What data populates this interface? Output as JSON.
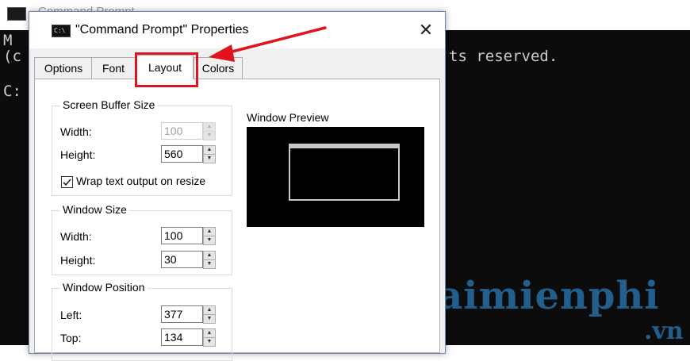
{
  "background_window": {
    "title": "Command Prompt",
    "console_lines": [
      "M",
      "(c",
      "C:"
    ],
    "console_right_text": "ts reserved."
  },
  "watermark": {
    "text": "Taimienphi",
    "suffix": ".vn"
  },
  "dialog": {
    "title": "\"Command Prompt\" Properties",
    "close_label": "✕",
    "icon_text": "C:\\",
    "tabs": [
      {
        "label": "Options"
      },
      {
        "label": "Font"
      },
      {
        "label": "Layout",
        "active": true
      },
      {
        "label": "Colors"
      }
    ],
    "screen_buffer": {
      "title": "Screen Buffer Size",
      "width_label": "Width:",
      "width_value": "100",
      "height_label": "Height:",
      "height_value": "560",
      "wrap_label": "Wrap text output on resize",
      "wrap_checked": true
    },
    "window_size": {
      "title": "Window Size",
      "width_label": "Width:",
      "width_value": "100",
      "height_label": "Height:",
      "height_value": "30"
    },
    "window_position": {
      "title": "Window Position",
      "left_label": "Left:",
      "left_value": "377",
      "top_label": "Top:",
      "top_value": "134"
    },
    "preview": {
      "label": "Window Preview"
    }
  },
  "colors": {
    "highlight": "#e0141e",
    "console_bg": "#0c0c0c",
    "watermark": "#286ea5"
  }
}
